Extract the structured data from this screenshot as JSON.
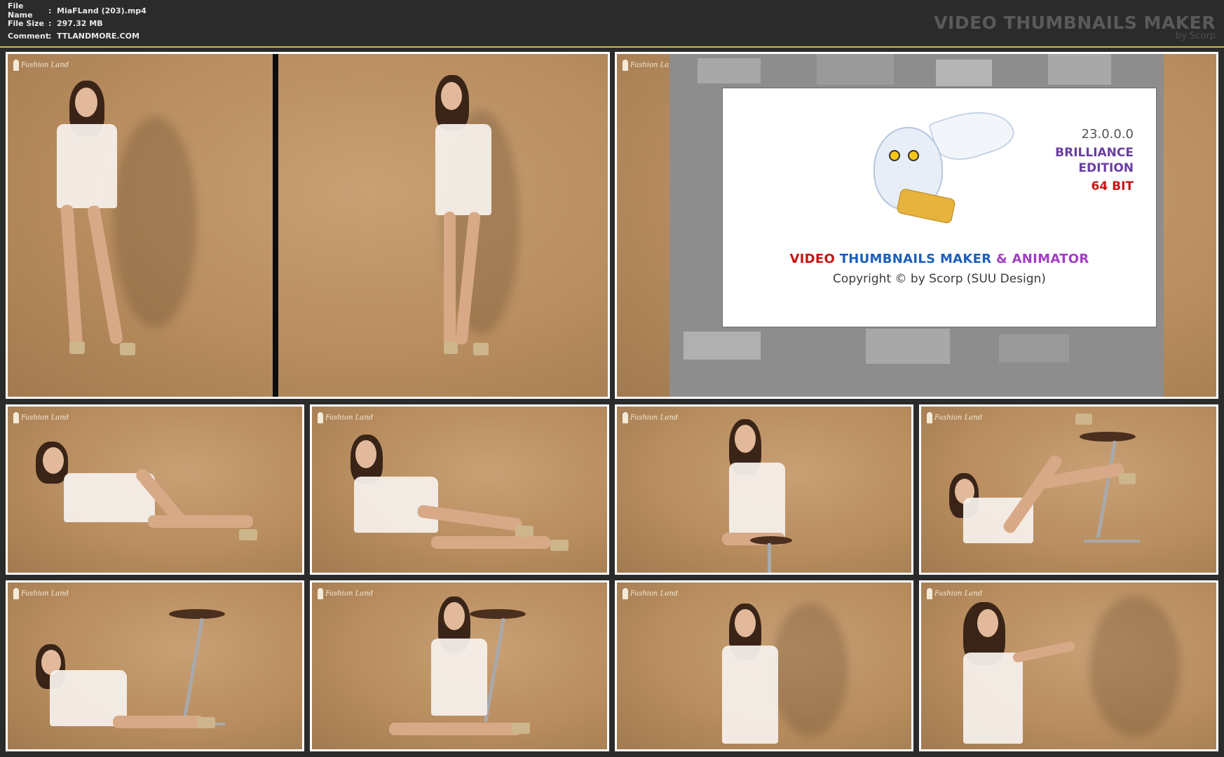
{
  "file_info": {
    "name_label": "File Name",
    "name_value": "MiaFLand (203).mp4",
    "size_label": "File Size",
    "size_value": "297.32 MB",
    "comment_label": "Comment",
    "comment_value": "TTLANDMORE.COM",
    "separator": ":"
  },
  "brand": {
    "title": "VIDEO THUMBNAILS MAKER",
    "by": "by Scorp"
  },
  "watermark": "Fashion Land",
  "splash": {
    "version": "23.0.0.0",
    "edition_line1": "BRILLIANCE",
    "edition_line2": "EDITION",
    "bits": "64 BIT",
    "title_word1": "VIDEO",
    "title_word2": "THUMBNAILS MAKER",
    "title_amp": "&",
    "title_word3": "ANIMATOR",
    "copyright": "Copyright © by Scorp (SUU Design)"
  },
  "colors": {
    "header_bg": "#2b2b2b",
    "accent_line": "#c9bf3a",
    "backdrop": "#b88d5f"
  }
}
